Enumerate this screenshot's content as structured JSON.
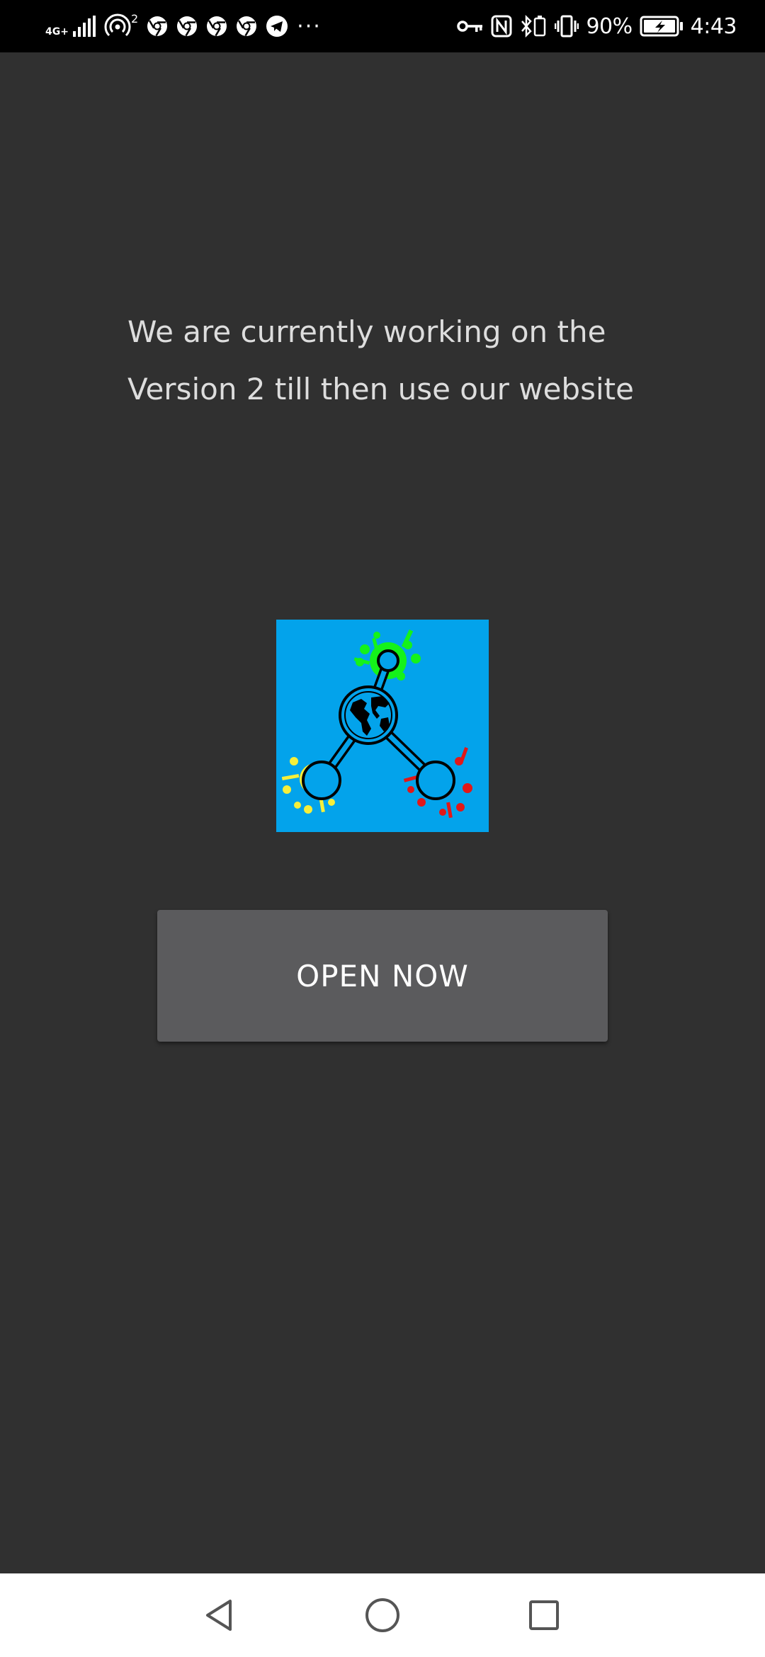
{
  "status_bar": {
    "network_type": "4G+",
    "hotspot_count": "2",
    "more": "···",
    "battery_percent": "90%",
    "time": "4:43",
    "icons_left": [
      "signal-icon",
      "hotspot-icon",
      "chrome-icon",
      "chrome-icon",
      "chrome-icon",
      "chrome-icon",
      "telegram-icon"
    ],
    "icons_right": [
      "vpn-key-icon",
      "nfc-icon",
      "bluetooth-icon",
      "vibrate-icon",
      "battery-charging-icon"
    ]
  },
  "main": {
    "message": "We are currently working on the Version 2 till then use our website",
    "open_button_label": "OPEN NOW"
  },
  "colors": {
    "background": "#303030",
    "logo_background": "#03a3eb",
    "button": "#5b5b5d"
  },
  "nav_bar": {
    "icons": [
      "back-icon",
      "home-icon",
      "recent-apps-icon"
    ]
  }
}
